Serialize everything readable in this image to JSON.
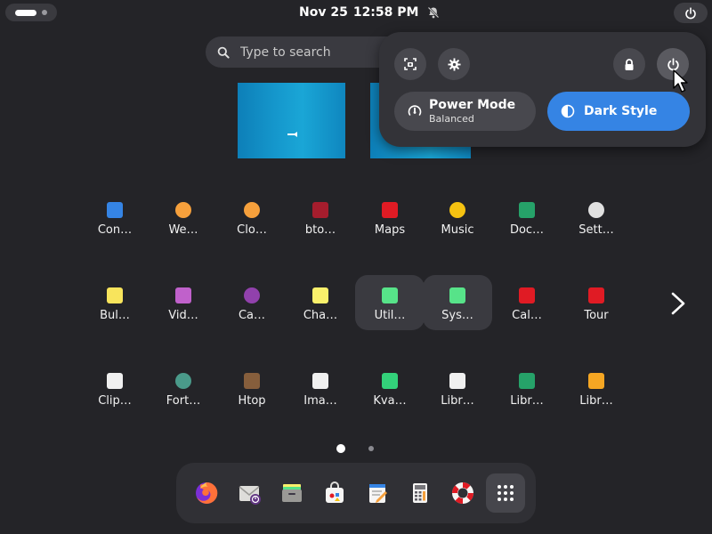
{
  "topbar": {
    "date": "Nov 25",
    "time": "12:58 PM"
  },
  "search": {
    "placeholder": "Type to search"
  },
  "apps": [
    {
      "label": "Con…",
      "icon": "contacts-icon",
      "color": "#3584e4"
    },
    {
      "label": "We…",
      "icon": "weather-icon",
      "color": "#f6a03c"
    },
    {
      "label": "Clo…",
      "icon": "clocks-icon",
      "color": "#f6a03c"
    },
    {
      "label": "bto…",
      "icon": "btop-icon",
      "color": "#a51d2d"
    },
    {
      "label": "Maps",
      "icon": "maps-icon",
      "color": "#e01b24"
    },
    {
      "label": "Music",
      "icon": "music-icon",
      "color": "#f5c211"
    },
    {
      "label": "Doc…",
      "icon": "document-scanner-icon",
      "color": "#26a269"
    },
    {
      "label": "Sett…",
      "icon": "settings-gear-icon",
      "color": "#e0e0e0"
    },
    {
      "label": "Bul…",
      "icon": "bulk-rename-icon",
      "color": "#f8e45c"
    },
    {
      "label": "Vid…",
      "icon": "videos-icon",
      "color": "#c061cb"
    },
    {
      "label": "Ca…",
      "icon": "camera-icon",
      "color": "#9141ac"
    },
    {
      "label": "Cha…",
      "icon": "characters-icon",
      "color": "#f9f06b"
    },
    {
      "label": "Util…",
      "icon": "utilities-folder-icon",
      "color": "#57e389"
    },
    {
      "label": "Sys…",
      "icon": "system-folder-icon",
      "color": "#57e389"
    },
    {
      "label": "Cal…",
      "icon": "calendar-icon",
      "color": "#e01b24"
    },
    {
      "label": "Tour",
      "icon": "tour-balloon-icon",
      "color": "#e01b24"
    },
    {
      "label": "Clip…",
      "icon": "clipboard-icon",
      "color": "#f0f0f0"
    },
    {
      "label": "Fort…",
      "icon": "fortune-gear-icon",
      "color": "#4a9a8a"
    },
    {
      "label": "Htop",
      "icon": "htop-icon",
      "color": "#865e3c"
    },
    {
      "label": "Ima…",
      "icon": "image-viewer-icon",
      "color": "#f0f0f0"
    },
    {
      "label": "Kva…",
      "icon": "kvantum-icon",
      "color": "#33d17a"
    },
    {
      "label": "Libr…",
      "icon": "libreoffice-icon",
      "color": "#f0f0f0"
    },
    {
      "label": "Libr…",
      "icon": "libreoffice-calc-icon",
      "color": "#26a269"
    },
    {
      "label": "Libr…",
      "icon": "libreoffice-impress-icon",
      "color": "#f5a623"
    }
  ],
  "dock": [
    {
      "icon": "firefox-icon",
      "color": "#ff7139"
    },
    {
      "icon": "mail-client-icon",
      "color": "#c0bfbc"
    },
    {
      "icon": "file-manager-icon",
      "color": "#9a9996"
    },
    {
      "icon": "software-store-icon",
      "color": "#f6f5f4"
    },
    {
      "icon": "text-editor-icon",
      "color": "#3584e4"
    },
    {
      "icon": "calculator-icon",
      "color": "#f6f5f4"
    },
    {
      "icon": "help-lifebuoy-icon",
      "color": "#e01b24"
    },
    {
      "icon": "show-apps-grid-icon",
      "color": "#ffffff"
    }
  ],
  "quick_settings": {
    "power_mode": {
      "title": "Power Mode",
      "subtitle": "Balanced"
    },
    "dark_style": {
      "title": "Dark Style",
      "active_color": "#3584e4"
    }
  },
  "colors": {
    "background": "#242428",
    "panel": "#333338",
    "accent": "#3584e4",
    "workspace": "#1597cc"
  },
  "pages": {
    "current": 1,
    "total": 2
  }
}
